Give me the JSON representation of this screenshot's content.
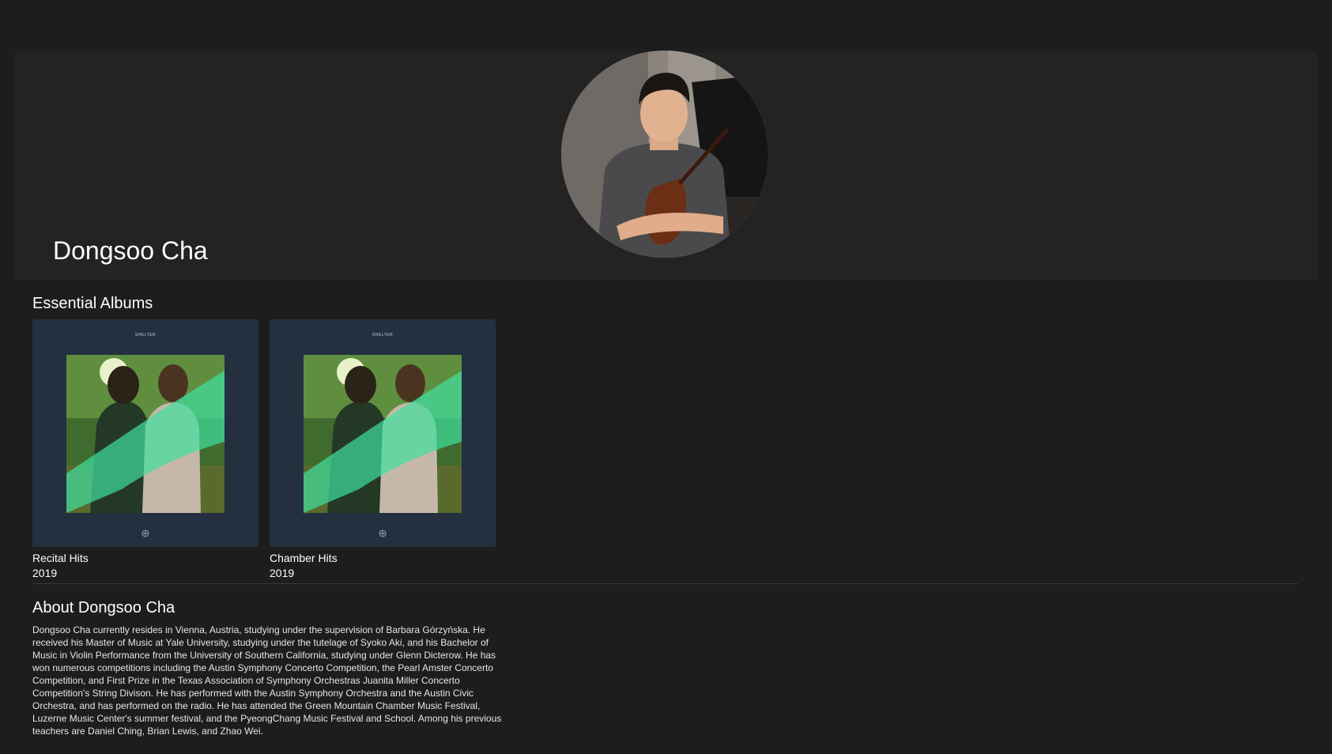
{
  "artist": {
    "name": "Dongsoo Cha"
  },
  "essential_albums": {
    "title": "Essential Albums",
    "albums": [
      {
        "title": "Recital Hits",
        "year": "2019",
        "cover_text": "SHELTER"
      },
      {
        "title": "Chamber Hits",
        "year": "2019",
        "cover_text": "SHELTER"
      }
    ]
  },
  "about": {
    "title": "About Dongsoo Cha",
    "text": "Dongsoo Cha currently resides in Vienna, Austria, studying under the supervision of Barbara Górzyńska. He received his Master of Music at Yale University, studying under the tutelage of Syoko Aki, and his Bachelor of Music in Violin Performance from the University of Southern California, studying under Glenn Dicterow. He has won numerous competitions including the Austin Symphony Concerto Competition, the Pearl Amster Concerto Competition, and First Prize in the Texas Association of Symphony Orchestras Juanita Miller Concerto Competition's String Divison. He has performed with the Austin Symphony Orchestra and the Austin Civic Orchestra, and has performed on the radio. He has attended the Green Mountain Chamber Music Festival, Luzerne Music Center's summer festival, and the PyeongChang Music Festival and School. Among his previous teachers are Daniel Ching, Brian Lewis, and Zhao Wei."
  },
  "colors": {
    "background": "#1d1d1e",
    "hero_background": "#232324",
    "album_cover_background": "#243040",
    "cover_accent": "#3fe0a0"
  }
}
